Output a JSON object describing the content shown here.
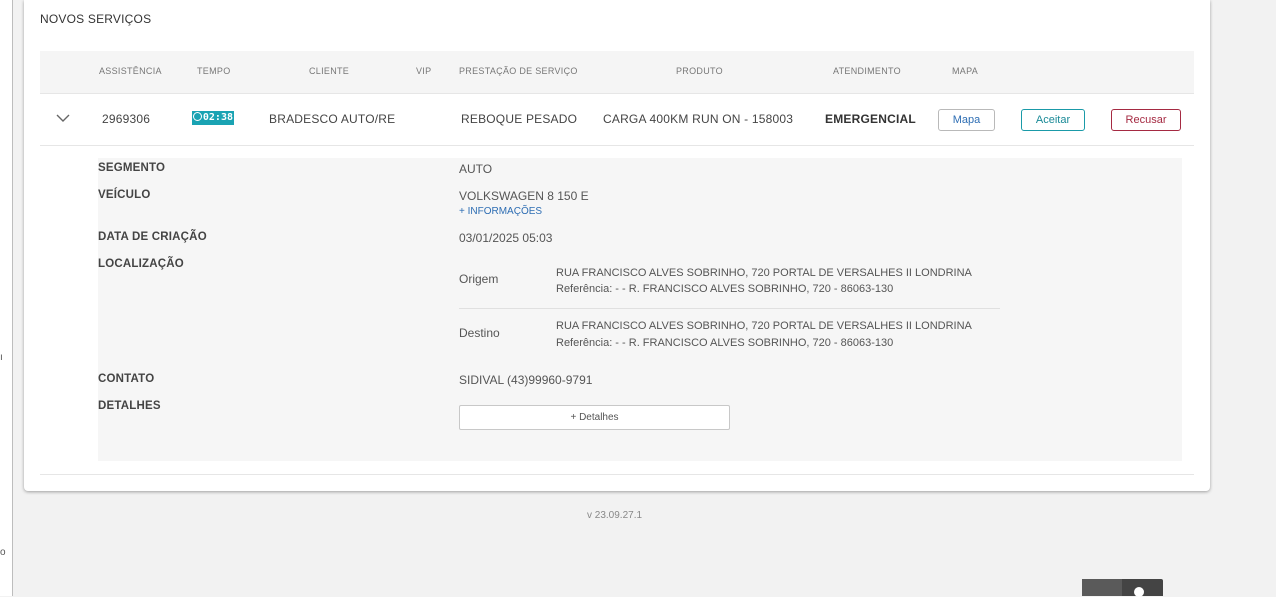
{
  "card": {
    "title": "NOVOS SERVIÇOS"
  },
  "table": {
    "headers": [
      "ASSISTÊNCIA",
      "TEMPO",
      "CLIENTE",
      "VIP",
      "PRESTAÇÃO DE SERVIÇO",
      "PRODUTO",
      "ATENDIMENTO",
      "MAPA"
    ],
    "row": {
      "assistencia": "2969306",
      "tempo": "02:38",
      "cliente": "BRADESCO AUTO/RE",
      "prestacao": "REBOQUE PESADO",
      "produto": "CARGA 400KM RUN ON - 158003",
      "atendimento": "EMERGENCIAL",
      "map_button": "Mapa",
      "accept_button": "Aceitar",
      "refuse_button": "Recusar"
    }
  },
  "details": {
    "segmento_label": "SEGMENTO",
    "segmento_value": "AUTO",
    "veiculo_label": "VEÍCULO",
    "veiculo_value": "VOLKSWAGEN 8 150 E",
    "more_info_link": "+ INFORMAÇÕES",
    "data_label": "DATA DE CRIAÇÃO",
    "data_value": "03/01/2025 05:03",
    "localizacao_label": "LOCALIZAÇÃO",
    "origem_label": "Origem",
    "origem_address": "RUA FRANCISCO ALVES SOBRINHO, 720 PORTAL DE VERSALHES II LONDRINA",
    "origem_reference": "Referência: - - R. FRANCISCO ALVES SOBRINHO, 720 - 86063-130",
    "destino_label": "Destino",
    "destino_address": "RUA FRANCISCO ALVES SOBRINHO, 720 PORTAL DE VERSALHES II LONDRINA",
    "destino_reference": "Referência: - - R. FRANCISCO ALVES SOBRINHO, 720 - 86063-130",
    "contato_label": "CONTATO",
    "contato_value": "SIDIVAL (43)99960-9791",
    "detalhes_label": "DETALHES",
    "detalhes_button": "+ Detalhes"
  },
  "footer": {
    "version": "v 23.09.27.1"
  },
  "colors": {
    "accent": "#1aa3b3",
    "danger": "#a52a42",
    "link": "#2d6db3"
  }
}
